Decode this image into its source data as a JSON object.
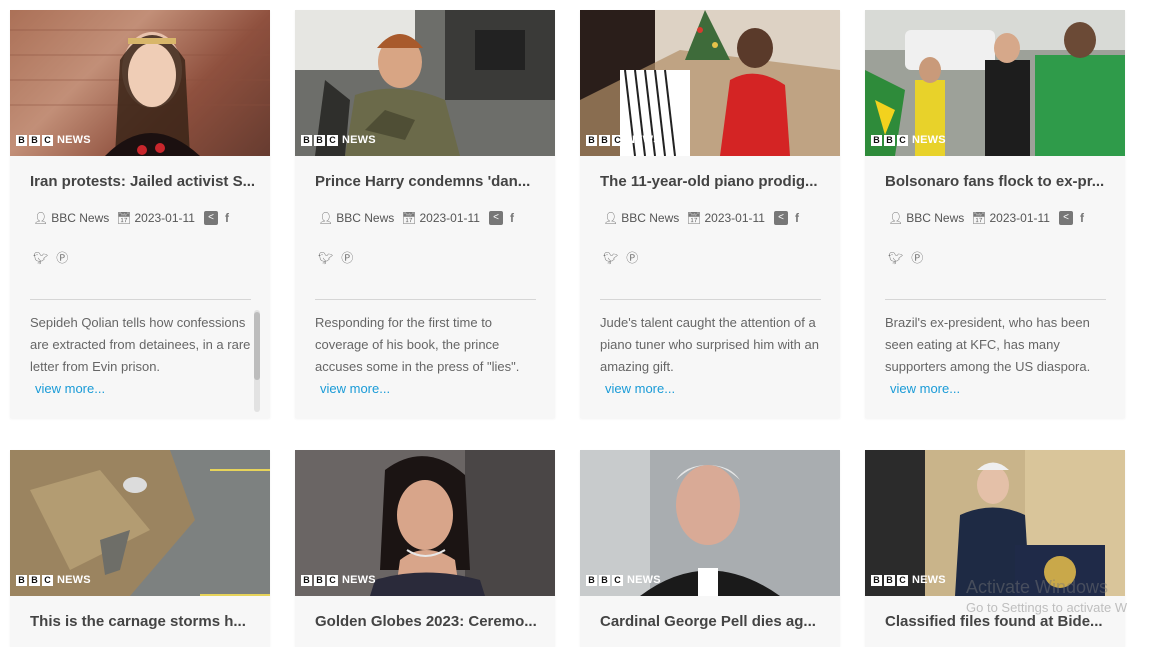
{
  "brand": {
    "logo_letters": [
      "B",
      "B",
      "C"
    ],
    "logo_word": "NEWS"
  },
  "view_more_label": "view more...",
  "cards": [
    {
      "title": "Iran protests: Jailed activist S...",
      "author": "BBC News",
      "date": "2023-01-11",
      "desc": "Sepideh Qolian tells how confessions are extracted from detainees, in a rare letter from Evin prison."
    },
    {
      "title": "Prince Harry condemns 'dan...",
      "author": "BBC News",
      "date": "2023-01-11",
      "desc": "Responding for the first time to coverage of his book, the prince accuses some in the press of \"lies\"."
    },
    {
      "title": "The 11-year-old piano prodig...",
      "author": "BBC News",
      "date": "2023-01-11",
      "desc": "Jude's talent caught the attention of a piano tuner who surprised him with an amazing gift."
    },
    {
      "title": "Bolsonaro fans flock to ex-pr...",
      "author": "BBC News",
      "date": "2023-01-11",
      "desc": "Brazil's ex-president, who has been seen eating at KFC, has many supporters among the US diaspora."
    },
    {
      "title": "This is the carnage storms h..."
    },
    {
      "title": "Golden Globes 2023: Ceremo..."
    },
    {
      "title": "Cardinal George Pell dies ag..."
    },
    {
      "title": "Classified files found at Bide..."
    }
  ],
  "watermark": {
    "line1": "Activate Windows",
    "line2": "Go to Settings to activate W"
  },
  "icons": [
    "user-icon",
    "calendar-icon",
    "share-icon",
    "facebook-icon",
    "twitter-icon",
    "pinterest-icon"
  ]
}
